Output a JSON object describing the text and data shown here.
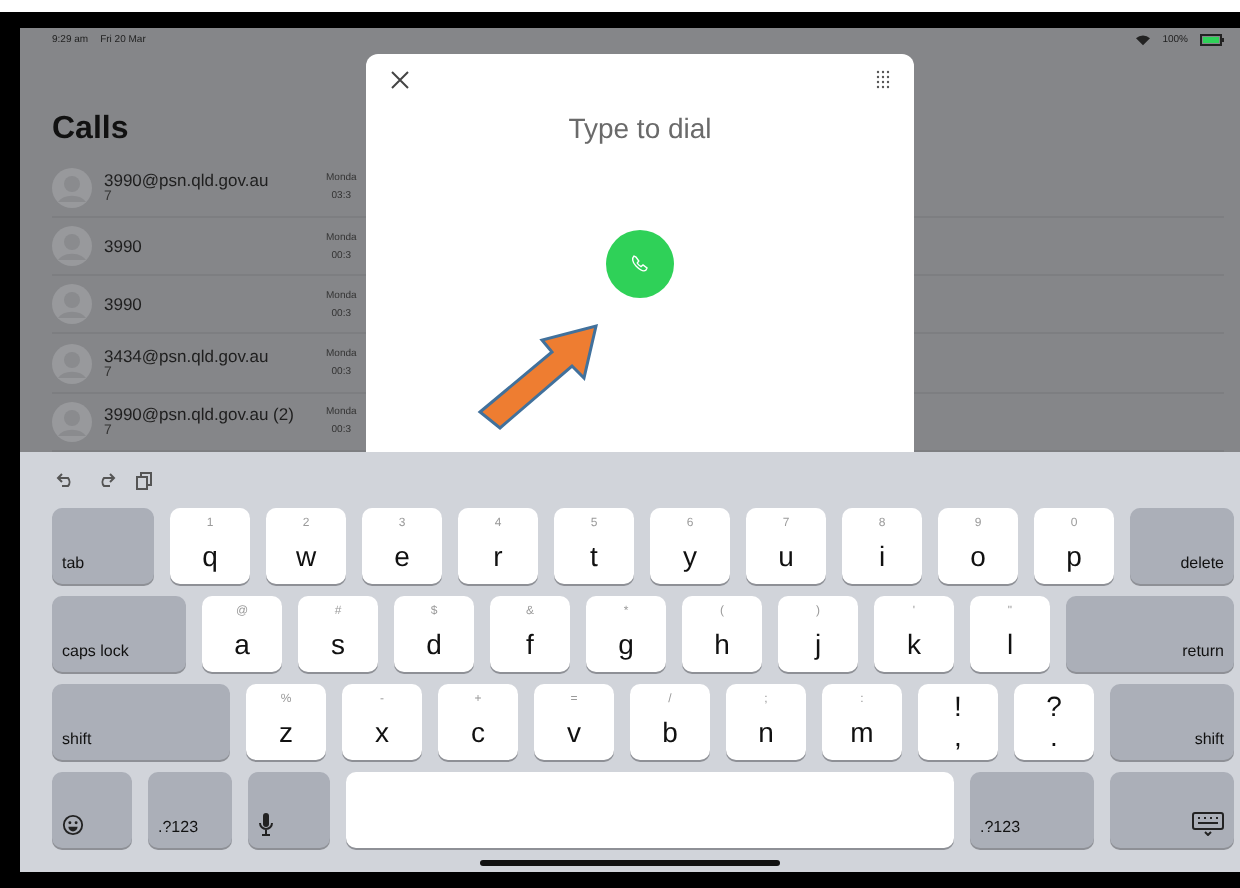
{
  "status_bar": {
    "time": "9:29 am",
    "date": "Fri 20 Mar",
    "battery": "100%"
  },
  "calls": {
    "title": "Calls",
    "rows": [
      {
        "name": "3990@psn.qld.gov.au",
        "detail": "7",
        "day": "Monda",
        "time": "03:3"
      },
      {
        "name": "3990",
        "day": "Monda",
        "time": "00:3"
      },
      {
        "name": "3990",
        "day": "Monda",
        "time": "00:3"
      },
      {
        "name": "3434@psn.qld.gov.au",
        "detail": "7",
        "day": "Monda",
        "time": "00:3"
      },
      {
        "name": "3990@psn.qld.gov.au (2)",
        "detail": "7",
        "day": "Monda",
        "time": "00:3"
      }
    ]
  },
  "dialer": {
    "placeholder": "Type to dial"
  },
  "keyboard": {
    "rows": [
      [
        {
          "kind": "function",
          "label": "tab"
        },
        {
          "kind": "letter",
          "label": "q",
          "alt": "1"
        },
        {
          "kind": "letter",
          "label": "w",
          "alt": "2"
        },
        {
          "kind": "letter",
          "label": "e",
          "alt": "3"
        },
        {
          "kind": "letter",
          "label": "r",
          "alt": "4"
        },
        {
          "kind": "letter",
          "label": "t",
          "alt": "5"
        },
        {
          "kind": "letter",
          "label": "y",
          "alt": "6"
        },
        {
          "kind": "letter",
          "label": "u",
          "alt": "7"
        },
        {
          "kind": "letter",
          "label": "i",
          "alt": "8"
        },
        {
          "kind": "letter",
          "label": "o",
          "alt": "9"
        },
        {
          "kind": "letter",
          "label": "p",
          "alt": "0"
        },
        {
          "kind": "function",
          "label": "delete"
        }
      ],
      [
        {
          "kind": "function",
          "label": "caps lock"
        },
        {
          "kind": "letter",
          "label": "a",
          "alt": "@"
        },
        {
          "kind": "letter",
          "label": "s",
          "alt": "#"
        },
        {
          "kind": "letter",
          "label": "d",
          "alt": "$"
        },
        {
          "kind": "letter",
          "label": "f",
          "alt": "&"
        },
        {
          "kind": "letter",
          "label": "g",
          "alt": "*"
        },
        {
          "kind": "letter",
          "label": "h",
          "alt": "("
        },
        {
          "kind": "letter",
          "label": "j",
          "alt": ")"
        },
        {
          "kind": "letter",
          "label": "k",
          "alt": "'"
        },
        {
          "kind": "letter",
          "label": "l",
          "alt": "\""
        },
        {
          "kind": "function",
          "label": "return"
        }
      ],
      [
        {
          "kind": "function",
          "label": "shift"
        },
        {
          "kind": "letter",
          "label": "z",
          "alt": "%"
        },
        {
          "kind": "letter",
          "label": "x",
          "alt": "-"
        },
        {
          "kind": "letter",
          "label": "c",
          "alt": "+"
        },
        {
          "kind": "letter",
          "label": "v",
          "alt": "="
        },
        {
          "kind": "letter",
          "label": "b",
          "alt": "/"
        },
        {
          "kind": "letter",
          "label": "n",
          "alt": ";"
        },
        {
          "kind": "letter",
          "label": "m",
          "alt": ":"
        },
        {
          "kind": "punct",
          "label": ",",
          "alt": "!"
        },
        {
          "kind": "punct",
          "label": ".",
          "alt": "?"
        },
        {
          "kind": "function",
          "label": "shift"
        }
      ],
      [
        {
          "kind": "emoji"
        },
        {
          "kind": "function",
          "label": ".?123"
        },
        {
          "kind": "mic"
        },
        {
          "kind": "space"
        },
        {
          "kind": "function",
          "label": ".?123"
        },
        {
          "kind": "hide"
        }
      ]
    ]
  }
}
